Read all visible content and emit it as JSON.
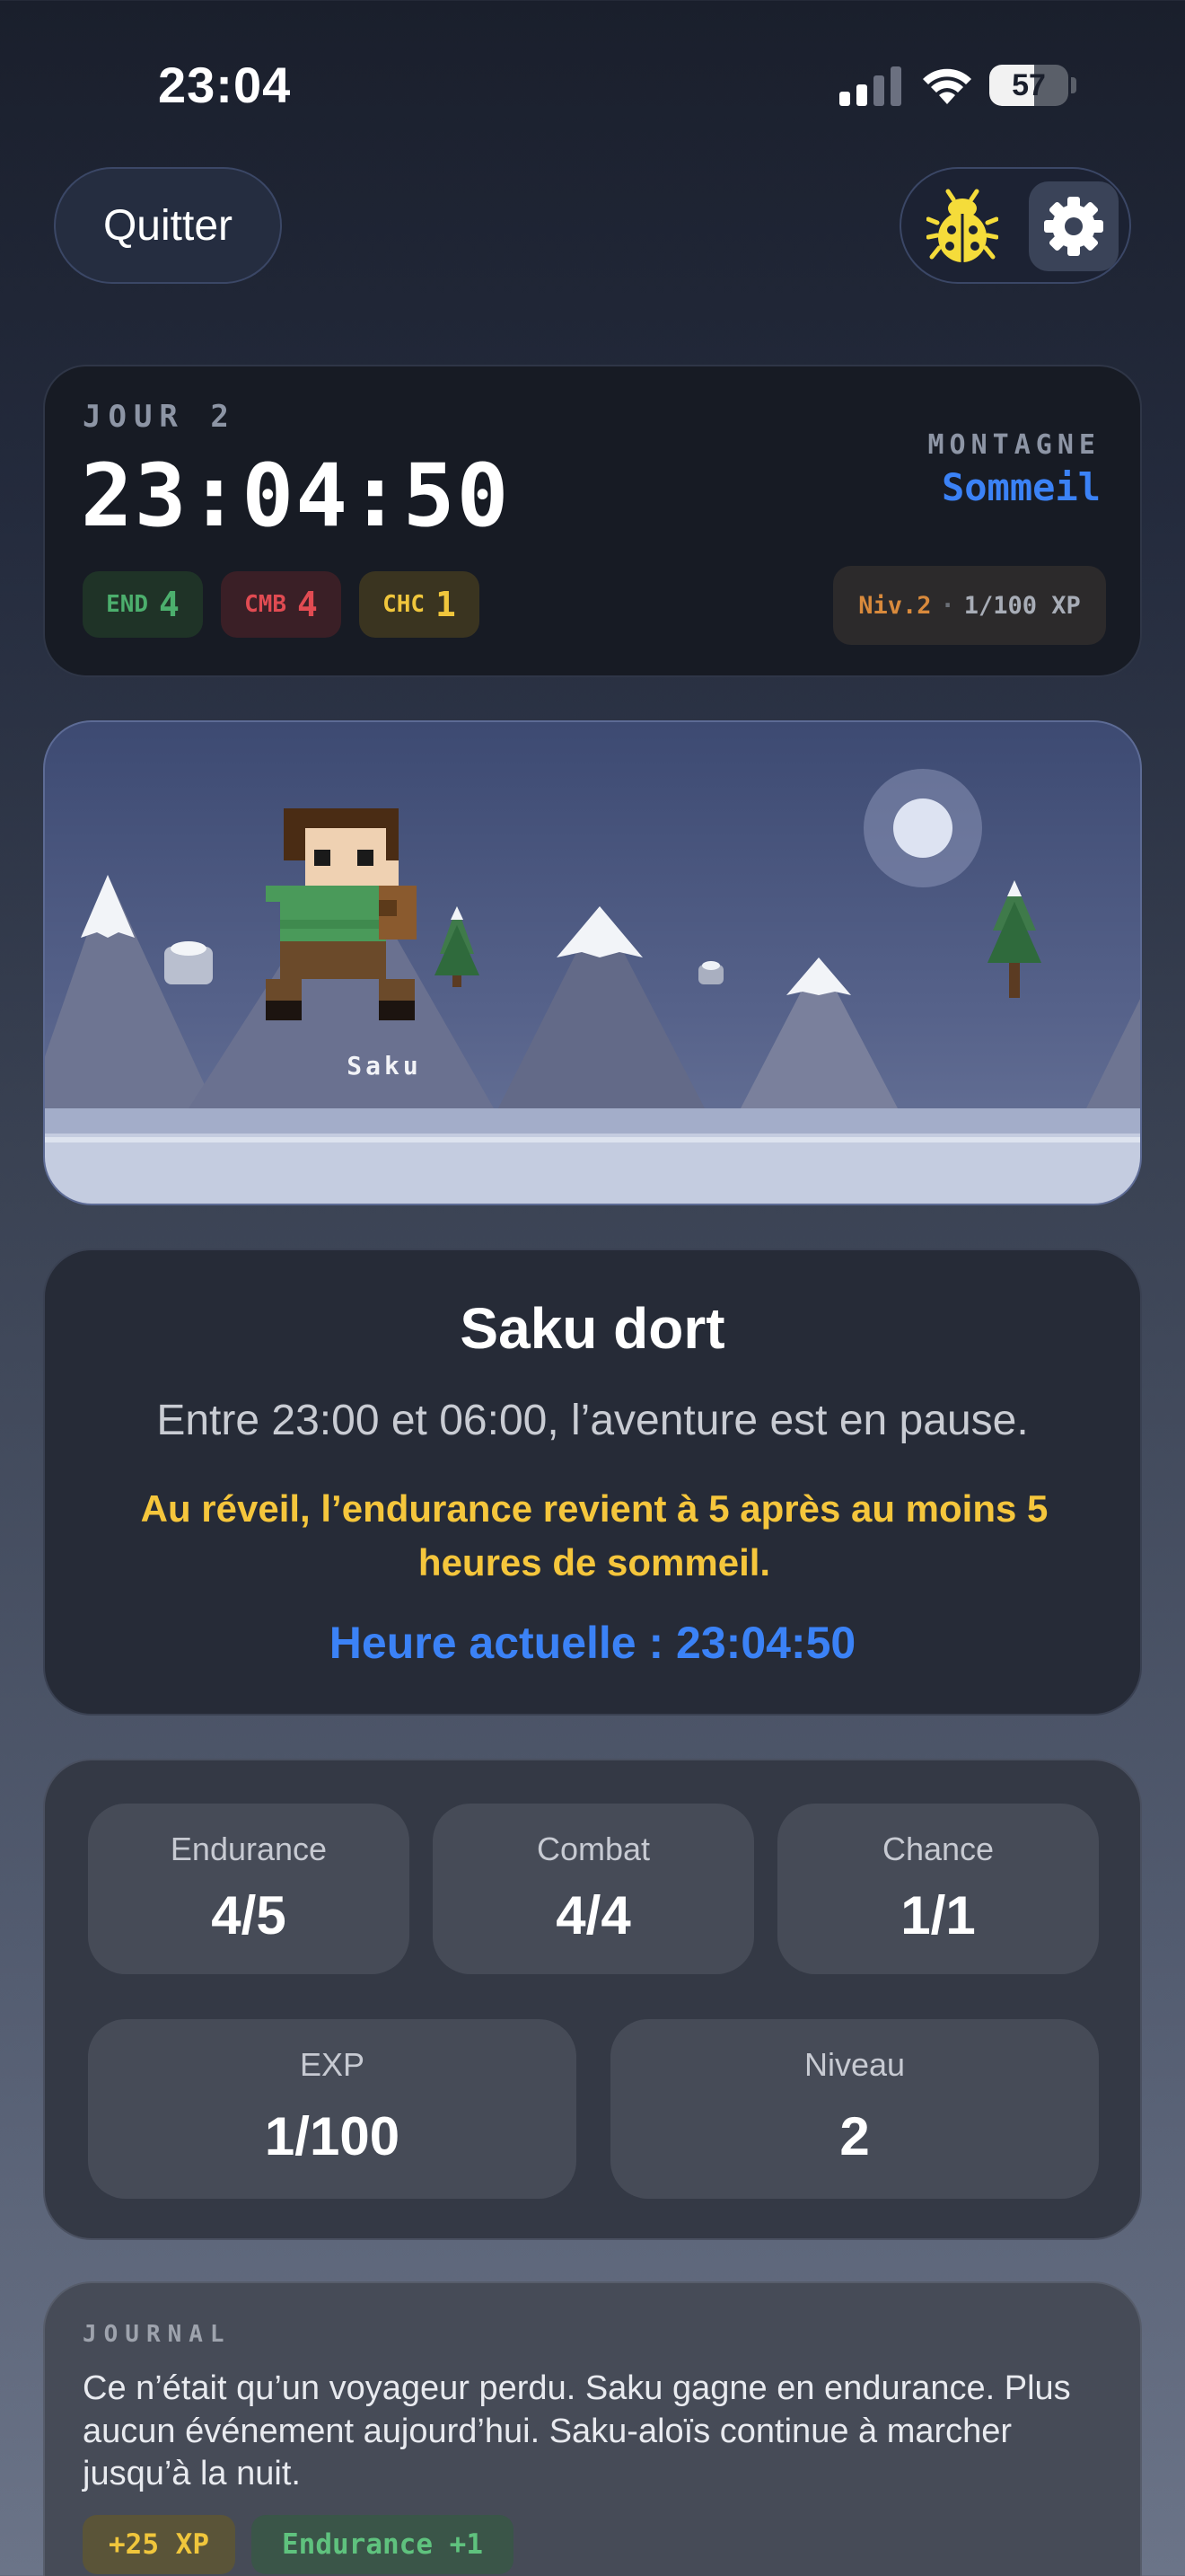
{
  "status_bar": {
    "time": "23:04",
    "battery_level": "57",
    "battery_fraction": 0.57
  },
  "header": {
    "quit_label": "Quitter",
    "bug_icon": "bug-icon",
    "settings_icon": "gear-icon"
  },
  "day": {
    "label": "JOUR 2",
    "clock": "23:04:50",
    "zone": "MONTAGNE",
    "phase": "Sommeil",
    "chips": [
      {
        "key": "END",
        "value": "4"
      },
      {
        "key": "CMB",
        "value": "4"
      },
      {
        "key": "CHC",
        "value": "1"
      }
    ],
    "level": "Niv.2",
    "separator": "·",
    "xp": "1/100 XP"
  },
  "scene": {
    "hero_name": "Saku"
  },
  "sleep": {
    "title": "Saku dort",
    "subtitle": "Entre 23:00 et 06:00, l’aventure est en pause.",
    "note": "Au réveil, l’endurance revient à 5 après au moins 5 heures de sommeil.",
    "current_time": "Heure actuelle : 23:04:50"
  },
  "stats": [
    {
      "label": "Endurance",
      "value": "4/5"
    },
    {
      "label": "Combat",
      "value": "4/4"
    },
    {
      "label": "Chance",
      "value": "1/1"
    },
    {
      "label": "EXP",
      "value": "1/100"
    },
    {
      "label": "Niveau",
      "value": "2"
    }
  ],
  "journal": {
    "label": "JOURNAL",
    "text": "Ce n’était qu’un voyageur perdu. Saku gagne en endurance. Plus aucun événement aujourd’hui. Saku-aloïs continue à marcher jusqu’à la nuit.",
    "tags": [
      "+25 XP",
      "Endurance +1"
    ]
  },
  "colors": {
    "accent_blue": "#3b82f6",
    "warning_yellow": "#f5c63c",
    "endurance_green": "#4caf6d",
    "combat_red": "#e14b52"
  }
}
